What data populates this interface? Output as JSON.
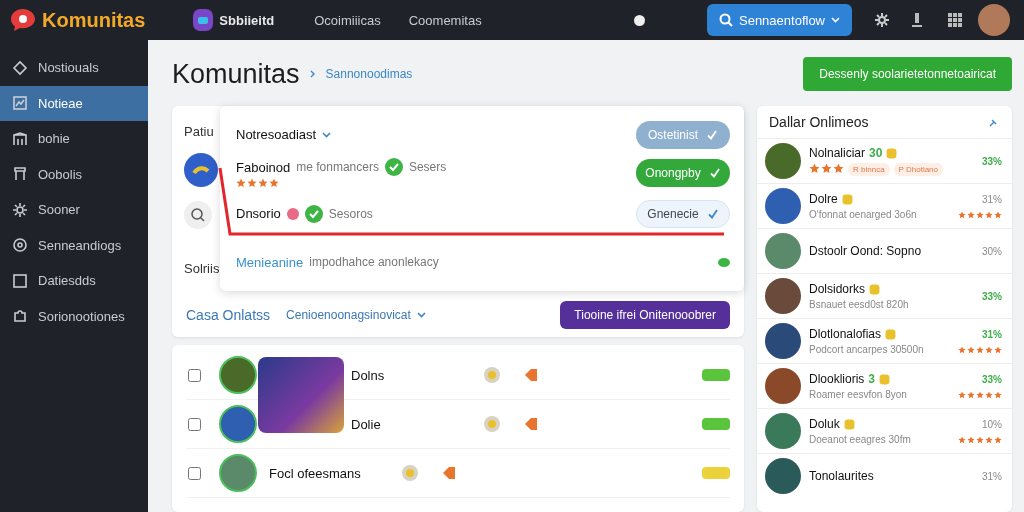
{
  "topbar": {
    "logo": "Komunitas",
    "app_name": "Sbbiieitd",
    "nav": [
      {
        "label": "Ocoimiiicas",
        "selected": false
      },
      {
        "label": "Coomemitas",
        "selected": false
      }
    ],
    "search_button": "Sennaentoflow"
  },
  "sidebar": {
    "items": [
      {
        "label": "Nostiouals",
        "selected": false
      },
      {
        "label": "Notieae",
        "selected": true
      },
      {
        "label": "bohie",
        "selected": false
      },
      {
        "label": "Oobolis",
        "selected": false
      },
      {
        "label": "Sooner",
        "selected": false
      },
      {
        "label": "Senneandiogs",
        "selected": false
      },
      {
        "label": "Datiesdds",
        "selected": false
      },
      {
        "label": "Sorionootiones",
        "selected": false
      }
    ]
  },
  "header": {
    "title": "Komunitas",
    "breadcrumb": "Sannonoodimas",
    "action_button": "Dessenly soolarietetonnetoairicat"
  },
  "panel": {
    "label_top": "Patiu",
    "label_bottom": "Solriis",
    "notifications": {
      "title": "Notresoadiast",
      "header_button": "Ostetinist",
      "items": [
        {
          "name": "Faboinod",
          "detail": "me fonmancers",
          "status": "Sesers",
          "stars": 4,
          "button": "Onongpby",
          "kind": "primary"
        },
        {
          "name": "Dnsorio",
          "status": "Sesoros",
          "alert": true,
          "button": "Gnenecie",
          "kind": "light"
        }
      ],
      "footer_link": "Menieanine",
      "footer_text": "impodhahce anonlekacy"
    },
    "filter_label": "Casa Onlatss",
    "filter_select": "Cenioenoonagsinovicat",
    "filter_button": "Tiooine ifrei Onitenooobrer"
  },
  "list": [
    {
      "name": "Dolns",
      "checked": false,
      "color": "#5ac43c"
    },
    {
      "name": "Dolie",
      "checked": false,
      "color": "#5ac43c"
    },
    {
      "name": "Focl ofeesmans",
      "checked": false,
      "color": "#ecd23a"
    }
  ],
  "online": {
    "title": "Dallar Onlimeos",
    "items": [
      {
        "name": "Nolnaliciar",
        "count": "30",
        "tags": [
          "R binnca",
          "P Dhotiano"
        ],
        "percent": "33%",
        "highlighted": true,
        "stars": 3
      },
      {
        "name": "Dolre",
        "sub": "O'fonnat oenarged 3o6n",
        "percent": "31%",
        "highlighted": false,
        "stars": 5
      },
      {
        "name": "Dstoolr Oond: Sopno",
        "percent": "30%",
        "highlighted": false
      },
      {
        "name": "Dolsidorks",
        "sub": "Bsnauet eesd0st 820h",
        "percent": "33%",
        "highlighted": true
      },
      {
        "name": "Dlotlonalofias",
        "sub": "Podcort ancarpes 30500n",
        "percent": "31%",
        "highlighted": true,
        "stars": 5
      },
      {
        "name": "Dlooklioris",
        "count": "3",
        "sub": "Roamer eesvfon 8yon",
        "percent": "33%",
        "highlighted": true,
        "stars": 5
      },
      {
        "name": "Doluk",
        "sub": "Doeanot eeagres 30fm",
        "percent": "10%",
        "highlighted": false,
        "stars": 5
      },
      {
        "name": "Tonolaurites",
        "percent": "31%",
        "highlighted": false
      }
    ]
  }
}
